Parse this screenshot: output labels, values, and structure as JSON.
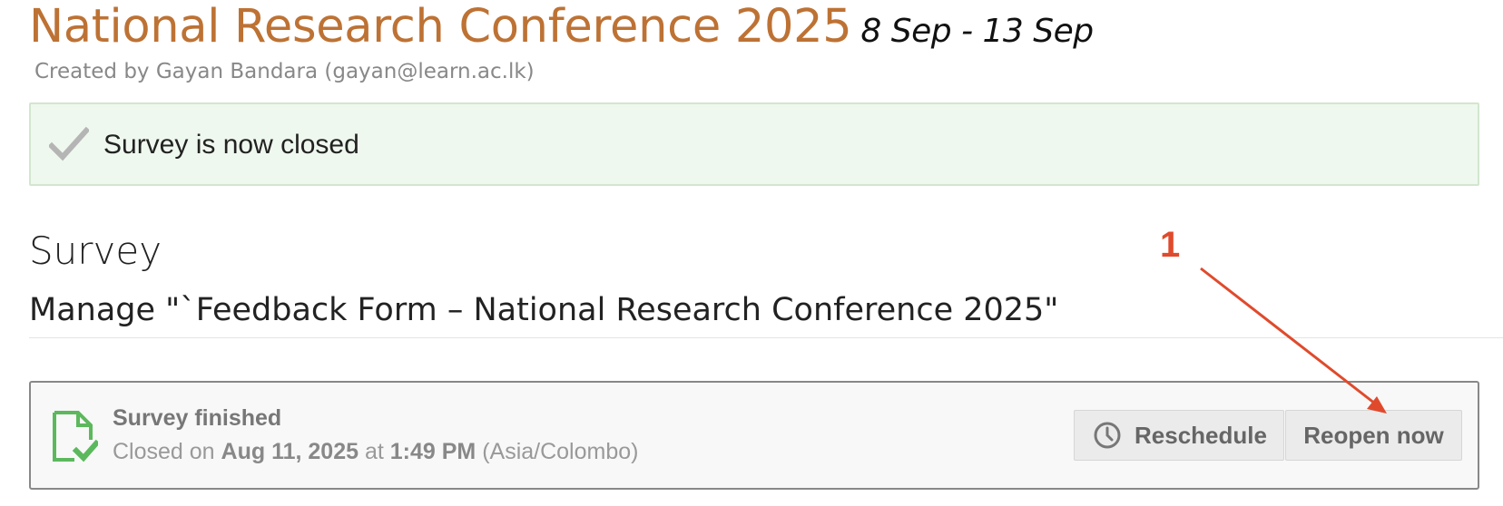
{
  "event": {
    "title": "National Research Conference 2025",
    "dates": "8 Sep - 13 Sep",
    "created_by": "Created by Gayan Bandara (gayan@learn.ac.lk)"
  },
  "alert": {
    "icon": "check-icon",
    "message": "Survey is now closed"
  },
  "survey": {
    "heading": "Survey",
    "manage_title": "Manage \"`Feedback Form – National Research Conference 2025\""
  },
  "status": {
    "icon": "document-check-icon",
    "title": "Survey finished",
    "closed_prefix": "Closed on ",
    "closed_date": "Aug 11, 2025",
    "closed_at": " at ",
    "closed_time": "1:49 PM",
    "closed_timezone": " (Asia/Colombo)"
  },
  "buttons": {
    "reschedule_label": "Reschedule",
    "reopen_label": "Reopen now"
  },
  "annotation": {
    "number": "1",
    "color": "#e04a2c"
  },
  "colors": {
    "title": "#bd7234",
    "alert_bg": "#eff8ee",
    "success_icon": "#5cb85c"
  }
}
